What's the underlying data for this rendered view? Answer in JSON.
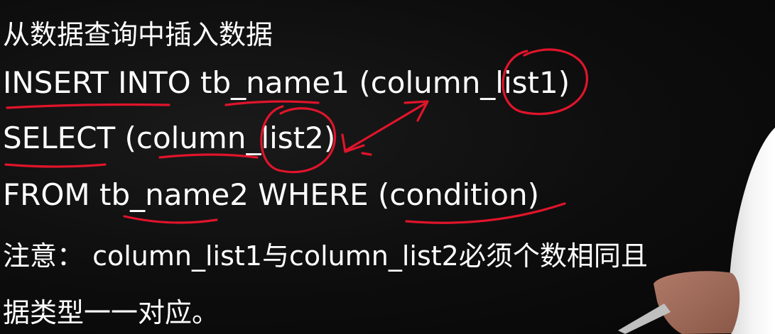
{
  "slide": {
    "lines": [
      "从数据查询中插入数据",
      "INSERT INTO tb_name1 (column_list1)",
      "SELECT (column_list2)",
      "FROM tb_name2 WHERE (condition)",
      "注意： column_list1与column_list2必须个数相同且",
      "据类型一一对应。"
    ]
  },
  "annotation": {
    "ink_color": "#e0142b"
  }
}
